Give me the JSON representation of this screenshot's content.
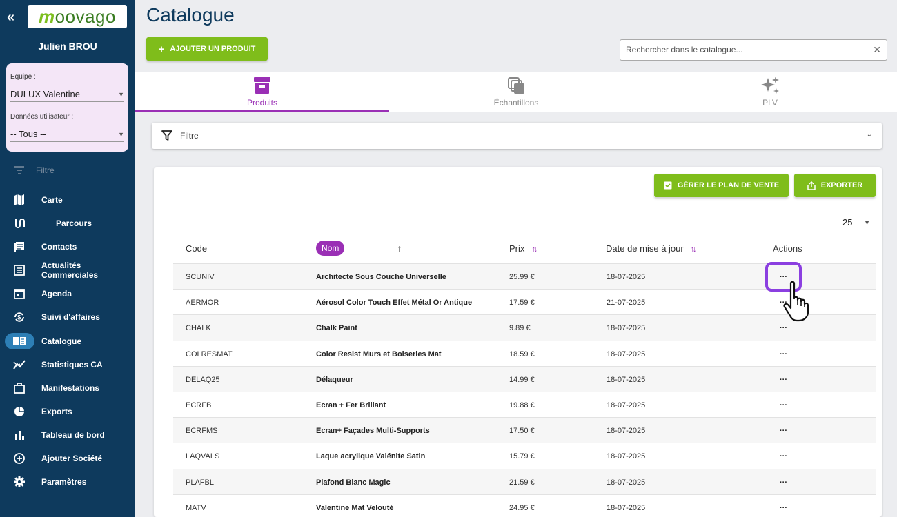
{
  "sidebar": {
    "collapse_icon": "double-chevron-left-icon",
    "logo_text": "moovago",
    "user_name": "Julien BROU",
    "team_label": "Equipe :",
    "team_value": "DULUX Valentine",
    "userdata_label": "Données utilisateur :",
    "userdata_value": "-- Tous --",
    "filter_link": "Filtre",
    "nav": [
      {
        "label": "Carte",
        "icon": "map-icon"
      },
      {
        "label": "Parcours",
        "icon": "route-icon"
      },
      {
        "label": "Contacts",
        "icon": "contacts-icon"
      },
      {
        "label": "Actualités Commerciales",
        "icon": "news-icon"
      },
      {
        "label": "Agenda",
        "icon": "calendar-icon"
      },
      {
        "label": "Suivi d'affaires",
        "icon": "deals-icon"
      },
      {
        "label": "Catalogue",
        "icon": "catalog-icon"
      },
      {
        "label": "Statistiques CA",
        "icon": "stats-icon"
      },
      {
        "label": "Manifestations",
        "icon": "briefcase-icon"
      },
      {
        "label": "Exports",
        "icon": "pie-chart-icon"
      },
      {
        "label": "Tableau de bord",
        "icon": "bar-chart-icon"
      },
      {
        "label": "Ajouter Société",
        "icon": "add-circle-icon"
      },
      {
        "label": "Paramètres",
        "icon": "gear-icon"
      }
    ]
  },
  "header": {
    "title": "Catalogue",
    "add_button": "AJOUTER UN PRODUIT",
    "search_placeholder": "Rechercher dans le catalogue..."
  },
  "tabs": [
    {
      "label": "Produits",
      "icon": "archive-box-icon",
      "active": true
    },
    {
      "label": "Échantillons",
      "icon": "stacked-squares-icon",
      "active": false
    },
    {
      "label": "PLV",
      "icon": "sparkle-icon",
      "active": false
    }
  ],
  "filter_bar": {
    "label": "Filtre"
  },
  "catalog": {
    "plan_button": "GÉRER LE PLAN DE VENTE",
    "export_button": "EXPORTER",
    "page_size": "25",
    "columns": {
      "code": "Code",
      "name": "Nom",
      "price": "Prix",
      "date": "Date de mise à jour",
      "actions": "Actions"
    },
    "rows": [
      {
        "code": "SCUNIV",
        "name": "Architecte Sous Couche Universelle",
        "price": "25.99 €",
        "date": "18-07-2025",
        "action": "···"
      },
      {
        "code": "AERMOR",
        "name": "Aérosol Color Touch Effet Métal Or Antique",
        "price": "17.59 €",
        "date": "21-07-2025",
        "action": "···"
      },
      {
        "code": "CHALK",
        "name": "Chalk Paint",
        "price": "9.89 €",
        "date": "18-07-2025",
        "action": "···"
      },
      {
        "code": "COLRESMAT",
        "name": "Color Resist Murs et Boiseries Mat",
        "price": "18.59 €",
        "date": "18-07-2025",
        "action": "···"
      },
      {
        "code": "DELAQ25",
        "name": "Délaqueur",
        "price": "14.99 €",
        "date": "18-07-2025",
        "action": "···"
      },
      {
        "code": "ECRFB",
        "name": "Ecran + Fer Brillant",
        "price": "19.88 €",
        "date": "18-07-2025",
        "action": "···"
      },
      {
        "code": "ECRFMS",
        "name": "Ecran+ Façades Multi-Supports",
        "price": "17.50 €",
        "date": "18-07-2025",
        "action": "···"
      },
      {
        "code": "LAQVALS",
        "name": "Laque acrylique Valénite Satin",
        "price": "15.79 €",
        "date": "18-07-2025",
        "action": "···"
      },
      {
        "code": "PLAFBL",
        "name": "Plafond Blanc Magic",
        "price": "21.59 €",
        "date": "18-07-2025",
        "action": "···"
      },
      {
        "code": "MATV",
        "name": "Valentine Mat Velouté",
        "price": "24.95 €",
        "date": "18-07-2025",
        "action": "···"
      }
    ]
  },
  "colors": {
    "sidebar": "#0e3a5d",
    "accent": "#9a2fb5",
    "green": "#7fbd1b",
    "highlight": "#8b3fe0"
  }
}
